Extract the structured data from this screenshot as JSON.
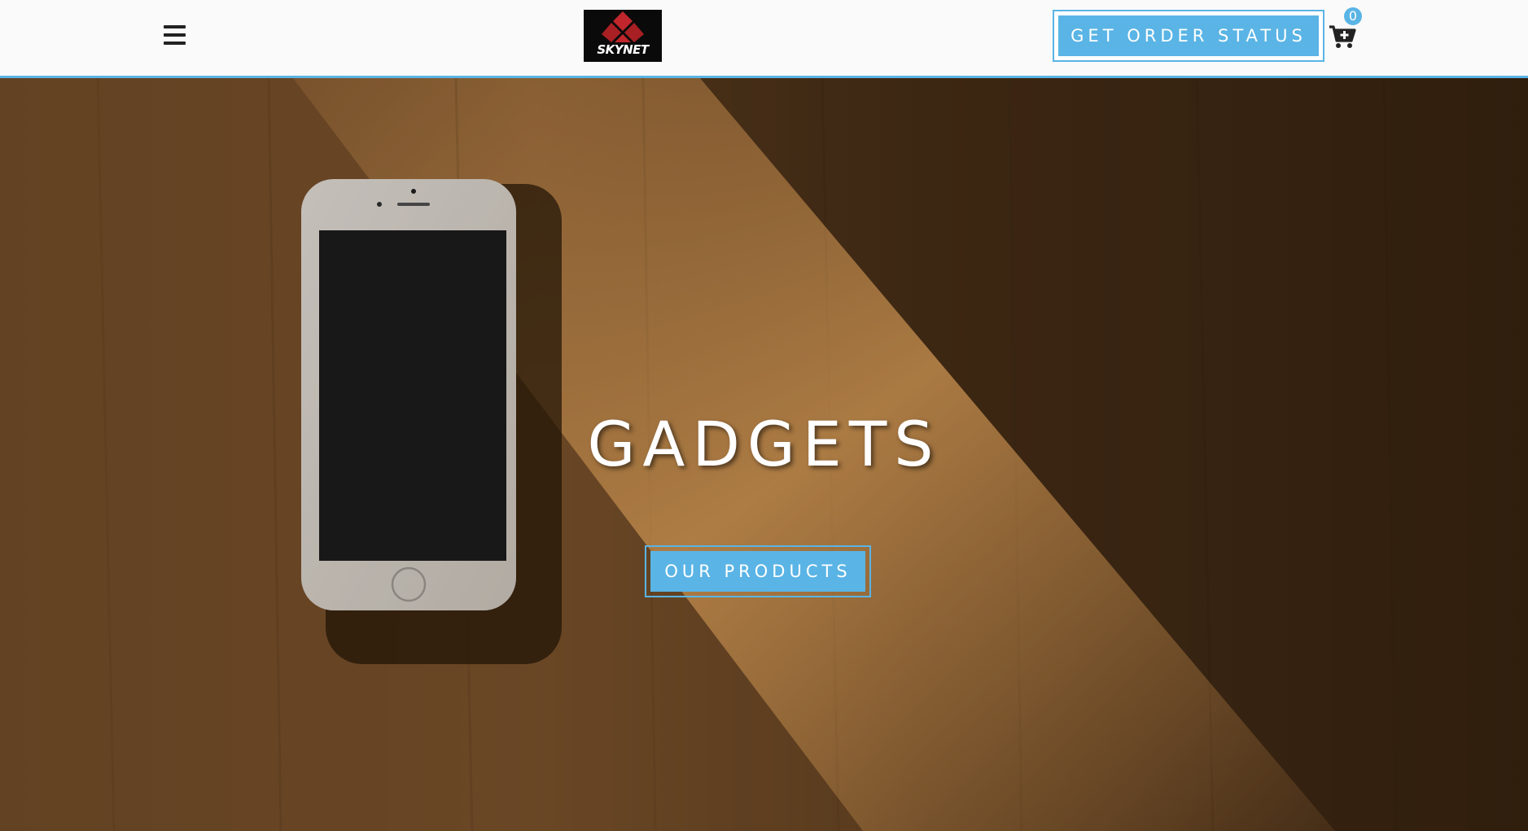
{
  "header": {
    "menu_icon": "hamburger-menu-icon",
    "logo_text": "SKYNET",
    "order_status_label": "GET ORDER STATUS",
    "cart_icon": "cart-plus-icon",
    "cart_count": "0"
  },
  "hero": {
    "title": "GADGETS",
    "cta_label": "OUR PRODUCTS",
    "background": "phone-on-wood-photo"
  },
  "colors": {
    "accent": "#5ab4e5",
    "header_bg": "#fafafa",
    "logo_bg": "#0a0a0a",
    "logo_red": "#c0262b"
  }
}
